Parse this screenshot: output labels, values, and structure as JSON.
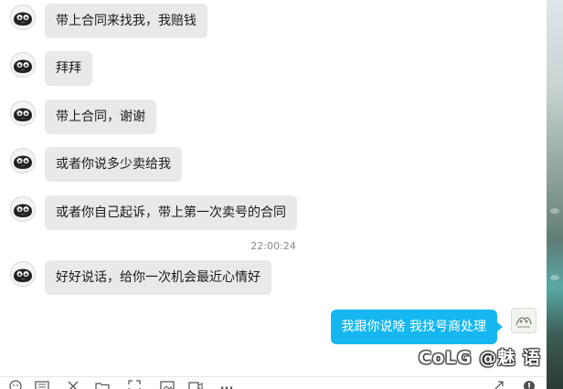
{
  "messages": [
    {
      "sender": "other",
      "text": "带上合同来找我，我赔钱"
    },
    {
      "sender": "other",
      "text": "拜拜"
    },
    {
      "sender": "other",
      "text": "带上合同，谢谢"
    },
    {
      "sender": "other",
      "text": "或者你说多少卖给我"
    },
    {
      "sender": "other",
      "text": "或者你自己起诉，带上第一次卖号的合同"
    },
    {
      "sender": "other",
      "text": "好好说话，给你一次机会最近心情好"
    },
    {
      "sender": "self",
      "text": "我跟你说啥 我找号商处理"
    }
  ],
  "timestamp": "22:00:24",
  "watermark": "CoLG @魅 语",
  "colors": {
    "self_bubble": "#16b7f0",
    "other_bubble": "#e9e9eb",
    "text_dark": "#1a1a1a"
  },
  "toolbar": {
    "icons": [
      "emoji-icon",
      "gif-icon",
      "scissors-icon",
      "folder-icon",
      "image-icon",
      "screenshot-icon",
      "video-icon",
      "more-icon",
      "expand-icon",
      "alert-icon"
    ],
    "more_label": "..."
  }
}
